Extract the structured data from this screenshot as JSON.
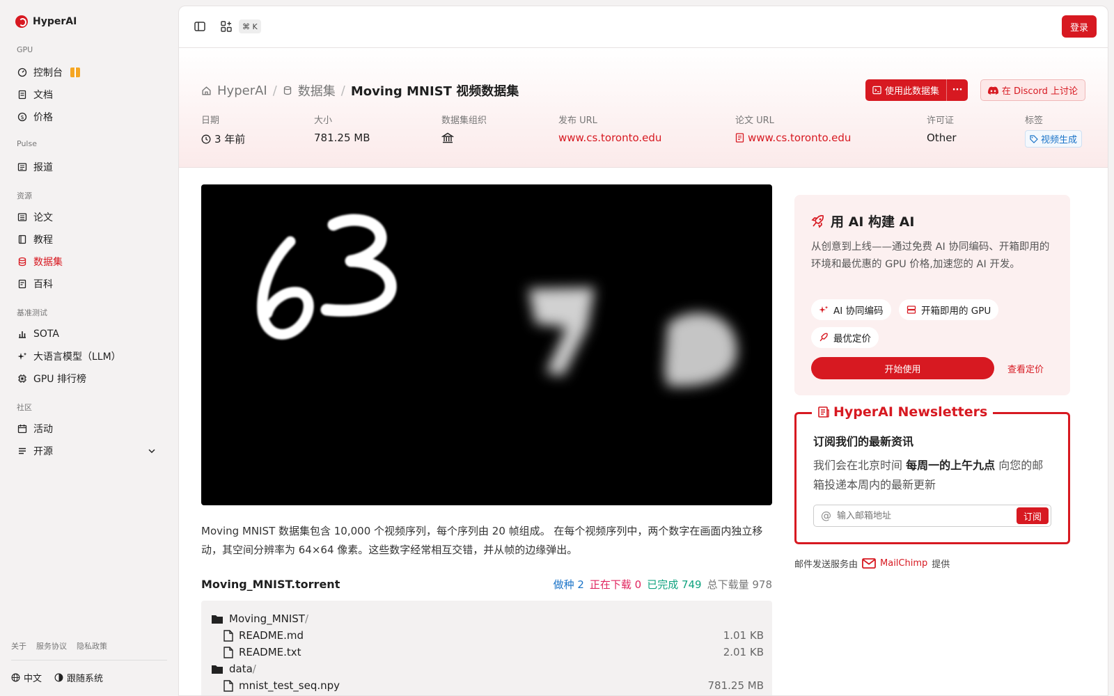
{
  "brand": "HyperAI",
  "sidebar": {
    "sections": [
      {
        "title": "GPU",
        "items": [
          {
            "label": "控制台",
            "icon": "gauge-icon"
          },
          {
            "label": "文档",
            "icon": "doc-icon"
          },
          {
            "label": "价格",
            "icon": "dollar-icon"
          }
        ]
      },
      {
        "title": "Pulse",
        "items": [
          {
            "label": "报道",
            "icon": "news-icon"
          }
        ]
      },
      {
        "title": "资源",
        "items": [
          {
            "label": "论文",
            "icon": "paper-icon"
          },
          {
            "label": "教程",
            "icon": "book-icon"
          },
          {
            "label": "数据集",
            "icon": "database-icon"
          },
          {
            "label": "百科",
            "icon": "wiki-icon"
          }
        ]
      },
      {
        "title": "基准测试",
        "items": [
          {
            "label": "SOTA",
            "icon": "bar-chart-icon"
          },
          {
            "label": "大语言模型（LLM）",
            "icon": "sparkle-icon"
          },
          {
            "label": "GPU 排行榜",
            "icon": "chip-icon"
          }
        ]
      },
      {
        "title": "社区",
        "items": [
          {
            "label": "活动",
            "icon": "calendar-icon"
          },
          {
            "label": "开源",
            "icon": "menu-icon"
          }
        ]
      }
    ],
    "footer_links": [
      "关于",
      "服务协议",
      "隐私政策"
    ],
    "language": "中文",
    "theme": "跟随系统"
  },
  "topbar": {
    "shortcut": "⌘ K",
    "login": "登录"
  },
  "breadcrumb": {
    "home": "HyperAI",
    "section": "数据集",
    "current": "Moving MNIST 视频数据集"
  },
  "actions": {
    "use_dataset": "使用此数据集",
    "more": "···",
    "discord": "在 Discord 上讨论"
  },
  "meta": {
    "date_label": "日期",
    "date": "3 年前",
    "size_label": "大小",
    "size": "781.25 MB",
    "org_label": "数据集组织",
    "release_label": "发布 URL",
    "release_url": "www.cs.toronto.edu",
    "paper_label": "论文 URL",
    "paper_url": "www.cs.toronto.edu",
    "license_label": "许可证",
    "license": "Other",
    "tags_label": "标签",
    "tag": "视频生成"
  },
  "description": "Moving MNIST 数据集包含 10,000 个视频序列，每个序列由 20 帧组成。 在每个视频序列中，两个数字在画面内独立移动，其空间分辨率为 64×64 像素。这些数字经常相互交错，并从帧的边缘弹出。",
  "torrent": {
    "name": "Moving_MNIST.torrent",
    "seeding": "做种 2",
    "downloading": "正在下载 0",
    "completed": "已完成 749",
    "total": "总下载量 978",
    "files": [
      {
        "name": "Moving_MNIST",
        "type": "folder",
        "size": ""
      },
      {
        "name": "README.md",
        "type": "file",
        "size": "1.01 KB"
      },
      {
        "name": "README.txt",
        "type": "file",
        "size": "2.01 KB"
      },
      {
        "name": "data",
        "type": "folder",
        "size": ""
      },
      {
        "name": "mnist_test_seq.npy",
        "type": "file",
        "size": "781.25 MB"
      }
    ]
  },
  "promo": {
    "title": "用 AI 构建 AI",
    "text": "从创意到上线——通过免费 AI 协同编码、开箱即用的环境和最优惠的 GPU 价格,加速您的 AI 开发。",
    "pills": [
      "AI 协同编码",
      "开箱即用的 GPU",
      "最优定价"
    ],
    "start": "开始使用",
    "pricing": "查看定价"
  },
  "newsletter": {
    "title": "HyperAI Newsletters",
    "heading": "订阅我们的最新资讯",
    "text_pre": "我们会在北京时间 ",
    "text_bold": "每周一的上午九点",
    "text_post": " 向您的邮箱投递本周内的最新更新",
    "placeholder": "输入邮箱地址",
    "subscribe": "订阅"
  },
  "mailchimp": {
    "pre": "邮件发送服务由",
    "brand": "MailChimp",
    "post": "提供"
  },
  "colors": {
    "accent": "#d71921",
    "seeding": "#1a73c8",
    "downloading": "#e0245e",
    "completed": "#10a37f",
    "total": "#777777"
  },
  "video_digits": [
    "6",
    "3",
    "7",
    "2"
  ]
}
